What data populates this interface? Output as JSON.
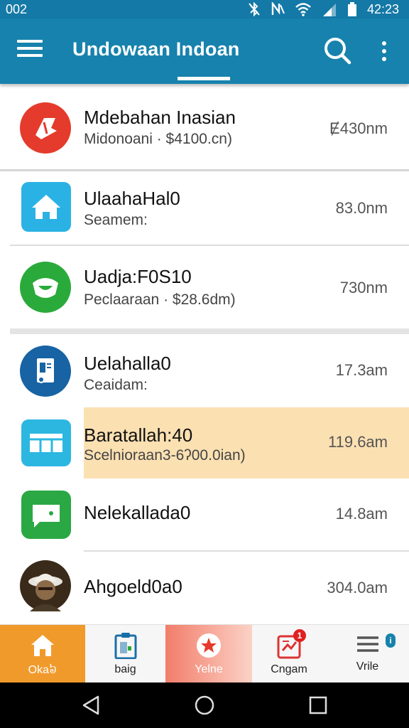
{
  "status_bar": {
    "time_left": "002",
    "clock": "42:23"
  },
  "app_bar": {
    "title": "Undowaan Indoan"
  },
  "rows": [
    {
      "name": "Mdebahan Inasian",
      "sub": "Midonoani · $4100.cn)",
      "time": "Ɇ430nm",
      "icon": "red-ribbon-icon",
      "color": "#e43b2c"
    },
    {
      "name": "UlaahaHal0",
      "sub": "Seamem:",
      "time": "83.0nm",
      "icon": "home-icon",
      "color": "#2bb2e4"
    },
    {
      "name": "Uadja:F0S10",
      "sub": "Peclaaraan · $28.6dm)",
      "time": "730nm",
      "icon": "chat-shield-icon",
      "color": "#2aaa3a"
    },
    {
      "name": "Uelahalla0",
      "sub": "Ceaidam:",
      "time": "17.3am",
      "icon": "document-icon",
      "color": "#1763a4"
    },
    {
      "name": "Baratallah:40",
      "sub": "Scelnioraan3-6ʔ00.0ian)",
      "time": "119.6am",
      "icon": "table-icon",
      "color": "#2cb7e1"
    },
    {
      "name": "Nelekallada0",
      "sub": "",
      "time": "14.8am",
      "icon": "message-icon",
      "color": "#2aa844"
    },
    {
      "name": "Ahgoeld0a0",
      "sub": "",
      "time": "304.0am",
      "icon": "avatar-photo",
      "color": "#3a2a1a"
    }
  ],
  "bottom_nav": [
    {
      "label": "Oka៦",
      "icon": "home-icon"
    },
    {
      "label": "baig",
      "icon": "clipboard-icon"
    },
    {
      "label": "Yelne",
      "icon": "star-burst-icon"
    },
    {
      "label": "Cngam",
      "icon": "chart-icon",
      "badge": "1"
    },
    {
      "label": "Vrile",
      "icon": "menu-lines-icon",
      "badge": "i"
    }
  ],
  "colors": {
    "app_bar": "#1782ad",
    "highlight": "#fbe0b2",
    "home_tab": "#f19a2c",
    "video_tab": "#f27d6a"
  }
}
